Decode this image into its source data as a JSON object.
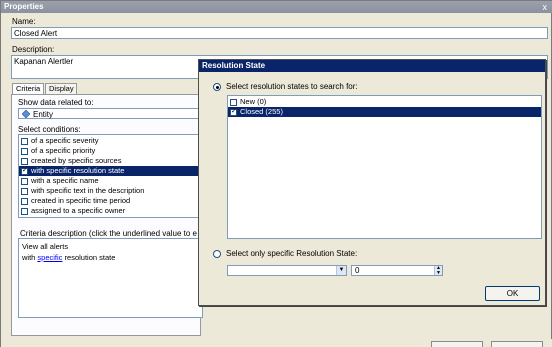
{
  "properties_window": {
    "title": "Properties",
    "close_glyph": "x",
    "name_label": "Name:",
    "name_value": "Closed Alert",
    "description_label": "Description:",
    "description_value": "Kapanan Alertler",
    "tabs": [
      {
        "label": "Criteria",
        "active": true
      },
      {
        "label": "Display",
        "active": false
      }
    ],
    "show_data_label": "Show data related to:",
    "show_data_value": "Entity",
    "select_conditions_label": "Select conditions:",
    "conditions": [
      {
        "label": "of a specific severity",
        "checked": false,
        "selected": false
      },
      {
        "label": "of a specific priority",
        "checked": false,
        "selected": false
      },
      {
        "label": "created by specific sources",
        "checked": false,
        "selected": false
      },
      {
        "label": "with specific resolution state",
        "checked": true,
        "selected": true
      },
      {
        "label": "with a specific name",
        "checked": false,
        "selected": false
      },
      {
        "label": "with specific text in the description",
        "checked": false,
        "selected": false
      },
      {
        "label": "created in specific time period",
        "checked": false,
        "selected": false
      },
      {
        "label": "assigned to a specific owner",
        "checked": false,
        "selected": false
      }
    ],
    "criteria_desc_label": "Criteria description (click the underlined value to e",
    "criteria_line1": "View all alerts",
    "criteria_line2_prefix": "with ",
    "criteria_line2_link": "specific",
    "criteria_line2_suffix": " resolution state"
  },
  "resolution_dialog": {
    "title": "Resolution State",
    "option1_label": "Select resolution states to search for:",
    "option1_selected": true,
    "states": [
      {
        "label": "New (0)",
        "checked": false,
        "selected": false
      },
      {
        "label": "Closed (255)",
        "checked": true,
        "selected": true
      }
    ],
    "option2_label": "Select only specific Resolution State:",
    "option2_selected": false,
    "dropdown_value": "",
    "spinner_value": "0",
    "ok_label": "OK"
  },
  "colors": {
    "selection": "#0a246a",
    "dialog_bg": "#ece9d8",
    "link": "#0000ee"
  }
}
